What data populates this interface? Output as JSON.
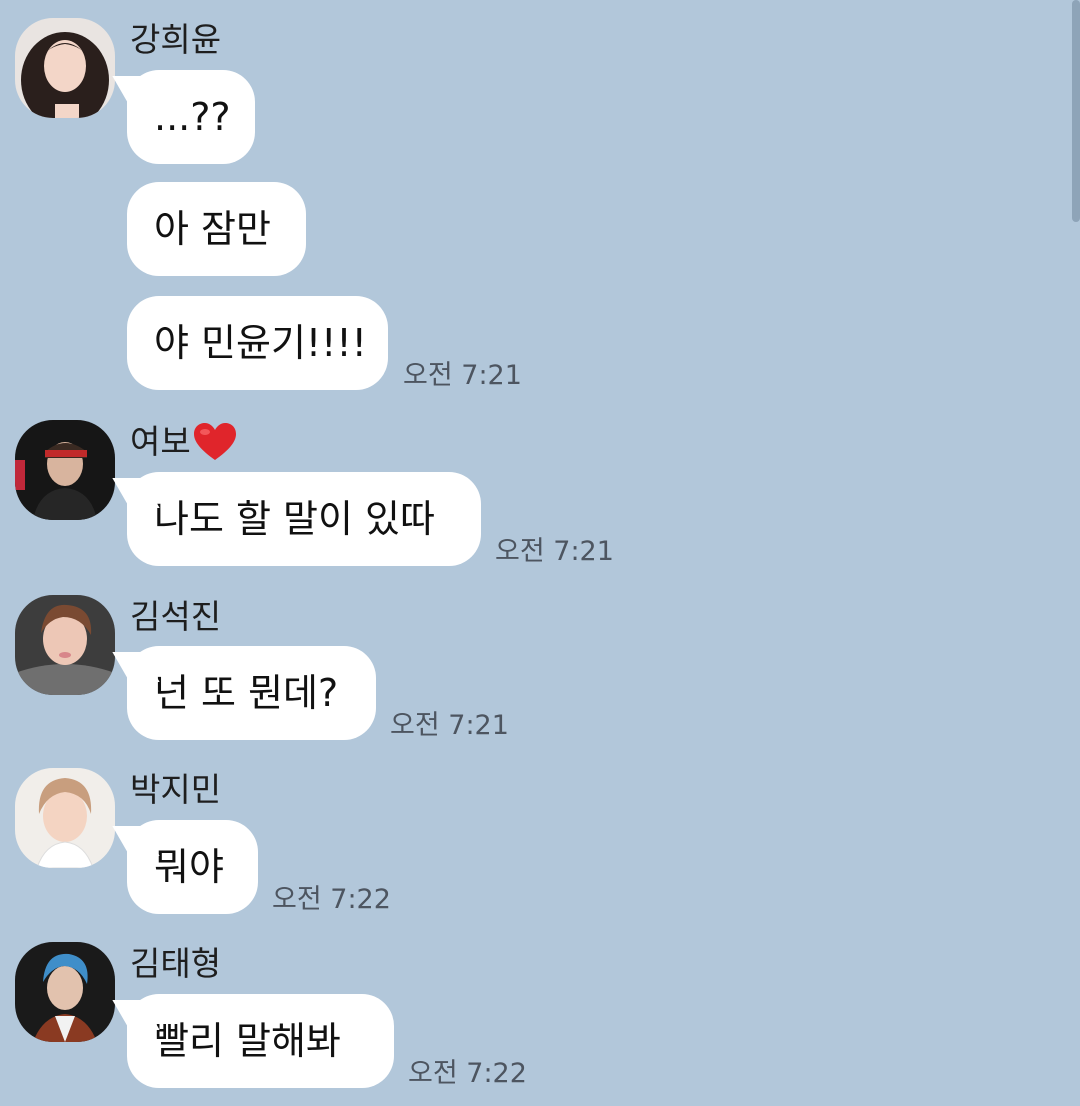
{
  "messages": [
    {
      "sender": "강희윤",
      "avatar": "profile-photo",
      "bubbles": [
        "...??",
        "아 잠만",
        "야 민윤기!!!!"
      ],
      "time": "오전 7:21"
    },
    {
      "sender": "여보",
      "sender_emoji": "heart-icon",
      "avatar": "profile-photo",
      "bubbles": [
        "나도 할 말이 있따"
      ],
      "time": "오전 7:21"
    },
    {
      "sender": "김석진",
      "avatar": "profile-photo",
      "bubbles": [
        "넌 또 뭔데?"
      ],
      "time": "오전 7:21"
    },
    {
      "sender": "박지민",
      "avatar": "profile-photo",
      "bubbles": [
        "뭐야"
      ],
      "time": "오전 7:22"
    },
    {
      "sender": "김태형",
      "avatar": "profile-photo",
      "bubbles": [
        "빨리 말해봐"
      ],
      "time": "오전 7:22"
    }
  ],
  "colors": {
    "background": "#b2c7da",
    "bubble": "#ffffff",
    "heart": "#e0252b"
  }
}
